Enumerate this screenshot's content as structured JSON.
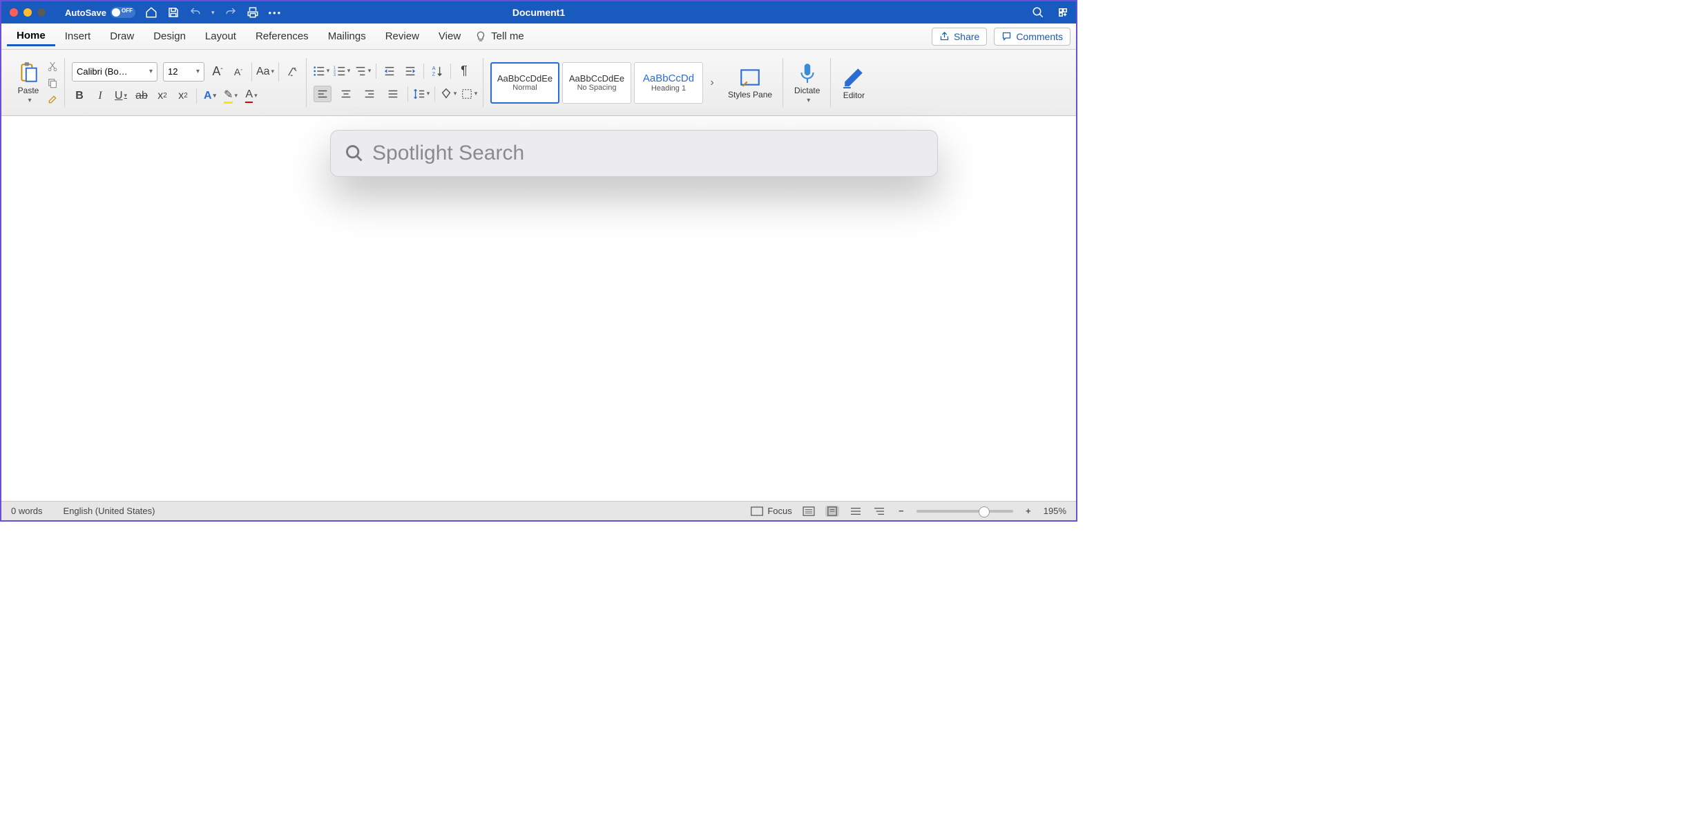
{
  "title": "Document1",
  "autosave": {
    "label": "AutoSave",
    "state": "OFF"
  },
  "tabs": [
    "Home",
    "Insert",
    "Draw",
    "Design",
    "Layout",
    "References",
    "Mailings",
    "Review",
    "View"
  ],
  "tellme": "Tell me",
  "share": "Share",
  "comments": "Comments",
  "clipboard": {
    "paste": "Paste"
  },
  "font": {
    "name": "Calibri (Bo…",
    "size": "12"
  },
  "styles": {
    "items": [
      {
        "sample": "AaBbCcDdEe",
        "name": "Normal"
      },
      {
        "sample": "AaBbCcDdEe",
        "name": "No Spacing"
      },
      {
        "sample": "AaBbCcDd",
        "name": "Heading 1"
      }
    ],
    "pane": "Styles Pane"
  },
  "dictate": "Dictate",
  "editor": "Editor",
  "spotlight_placeholder": "Spotlight Search",
  "status": {
    "words": "0 words",
    "lang": "English (United States)",
    "focus": "Focus",
    "zoom": "195%"
  }
}
